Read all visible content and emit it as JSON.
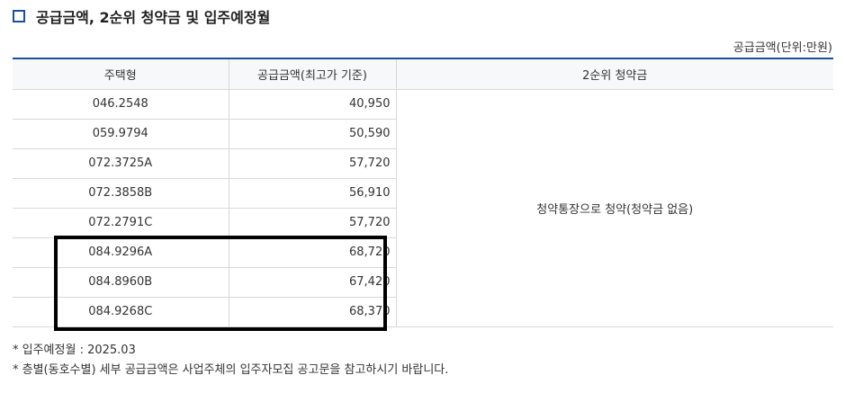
{
  "section": {
    "title": "공급금액, 2순위 청약금 및 입주예정월"
  },
  "table": {
    "unit_note": "공급금액(단위:만원)",
    "headers": {
      "type": "주택형",
      "price": "공급금액(최고가 기준)",
      "deposit": "2순위 청약금"
    },
    "rows": [
      {
        "type": "046.2548",
        "price": "40,950"
      },
      {
        "type": "059.9794",
        "price": "50,590"
      },
      {
        "type": "072.3725A",
        "price": "57,720"
      },
      {
        "type": "072.3858B",
        "price": "56,910"
      },
      {
        "type": "072.2791C",
        "price": "57,720"
      },
      {
        "type": "084.9296A",
        "price": "68,720"
      },
      {
        "type": "084.8960B",
        "price": "67,420"
      },
      {
        "type": "084.9268C",
        "price": "68,370"
      }
    ],
    "deposit_note": "청약통장으로 청약(청약금 없음)"
  },
  "footnotes": {
    "move_in": "* 입주예정월 : 2025.03",
    "floor_price": "* 층별(동호수별) 세부 공급금액은 사업주체의 입주자모집 공고문을 참고하시기 바랍니다."
  },
  "colors": {
    "accent": "#1a4fa0",
    "highlight_border": "#000000"
  }
}
